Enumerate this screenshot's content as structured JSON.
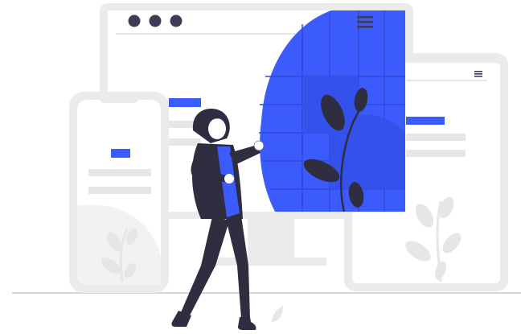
{
  "illustration": {
    "theme": "responsive web design illustration",
    "colors": {
      "accent": "#3b5bfd",
      "frame": "#ebebeb",
      "frame_inner": "#ffffff",
      "placeholder": "#e6e6e6",
      "dots": "#3f3d56",
      "figure_dark": "#2f2e41",
      "skin": "#ffffff",
      "plant_light": "#e6e6e6",
      "ground": "#d6d6d6"
    },
    "icons": [
      "hamburger-menu-icon",
      "window-dots-icon",
      "leaf-plant-icon"
    ]
  }
}
